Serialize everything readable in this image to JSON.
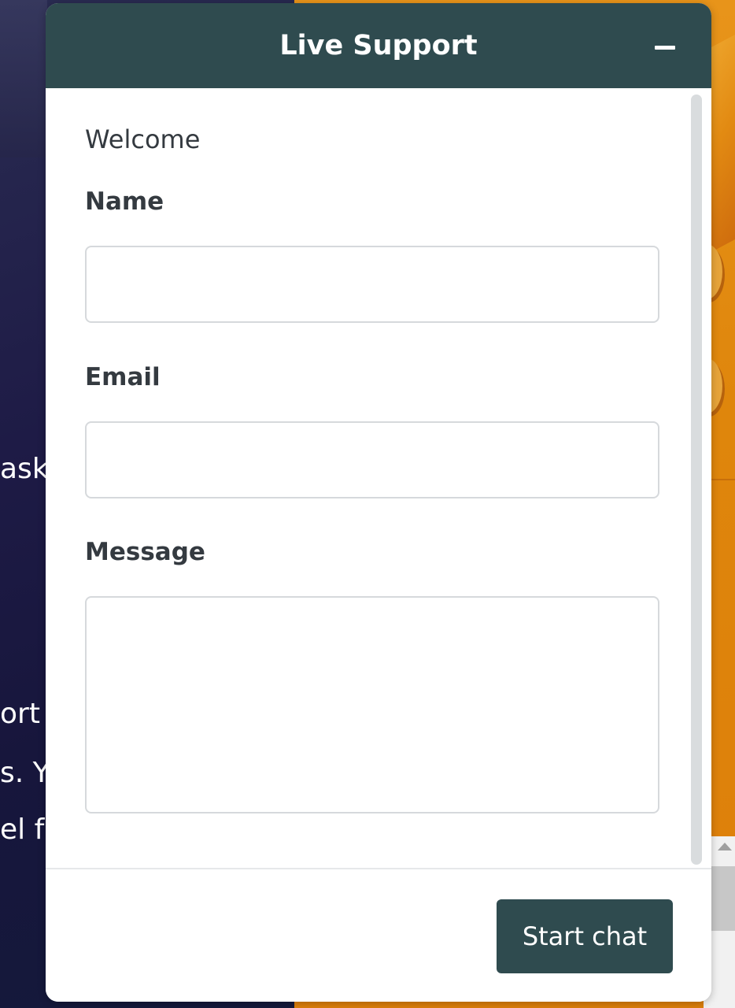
{
  "background": {
    "text_fragments": [
      "ask",
      "ort",
      "s. Y",
      "el fr"
    ]
  },
  "widget": {
    "title": "Live Support",
    "minimize_icon": "minus-icon",
    "welcome": "Welcome",
    "fields": {
      "name_label": "Name",
      "name_value": "",
      "email_label": "Email",
      "email_value": "",
      "message_label": "Message",
      "message_value": ""
    },
    "start_button": "Start chat"
  },
  "colors": {
    "header": "#2f4b4f",
    "button": "#2f4b4f",
    "text": "#343a40",
    "background_orange": "#df860c",
    "background_navy": "#1e1b46"
  }
}
